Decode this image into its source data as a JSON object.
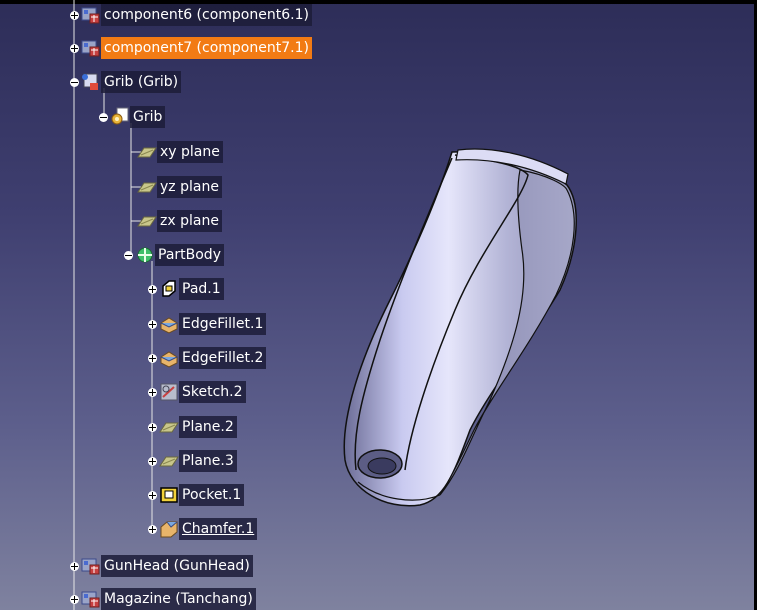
{
  "tree": {
    "nodes": [
      {
        "id": "component6",
        "label": "component6 (component6.1)",
        "icon": "component-icon",
        "expander": "plus",
        "selected": false
      },
      {
        "id": "component7",
        "label": "component7 (component7.1)",
        "icon": "component-icon",
        "expander": "plus",
        "selected": true
      },
      {
        "id": "grib-product",
        "label": "Grib (Grib)",
        "icon": "product-icon",
        "expander": "minus",
        "selected": false
      },
      {
        "id": "grib-part",
        "label": "Grib",
        "icon": "part-icon",
        "expander": "minus",
        "selected": false
      },
      {
        "id": "xy-plane",
        "label": "xy plane",
        "icon": "plane-icon",
        "expander": "none",
        "selected": false
      },
      {
        "id": "yz-plane",
        "label": "yz plane",
        "icon": "plane-icon",
        "expander": "none",
        "selected": false
      },
      {
        "id": "zx-plane",
        "label": "zx plane",
        "icon": "plane-icon",
        "expander": "none",
        "selected": false
      },
      {
        "id": "partbody",
        "label": "PartBody",
        "icon": "body-icon",
        "expander": "minus",
        "selected": false
      },
      {
        "id": "pad",
        "label": "Pad.1",
        "icon": "pad-icon",
        "expander": "plus",
        "selected": false
      },
      {
        "id": "edgefillet1",
        "label": "EdgeFillet.1",
        "icon": "fillet-icon",
        "expander": "plus",
        "selected": false
      },
      {
        "id": "edgefillet2",
        "label": "EdgeFillet.2",
        "icon": "fillet-icon",
        "expander": "plus",
        "selected": false
      },
      {
        "id": "sketch2",
        "label": "Sketch.2",
        "icon": "sketch-icon",
        "expander": "plus",
        "selected": false
      },
      {
        "id": "plane2",
        "label": "Plane.2",
        "icon": "plane-icon",
        "expander": "plus",
        "selected": false
      },
      {
        "id": "plane3",
        "label": "Plane.3",
        "icon": "plane-icon",
        "expander": "plus",
        "selected": false
      },
      {
        "id": "pocket1",
        "label": "Pocket.1",
        "icon": "pocket-icon",
        "expander": "plus",
        "selected": false
      },
      {
        "id": "chamfer1",
        "label": "Chamfer.1",
        "icon": "chamfer-icon",
        "expander": "plus",
        "selected": false,
        "underlined": true
      },
      {
        "id": "gunhead",
        "label": "GunHead (GunHead)",
        "icon": "component-icon",
        "expander": "plus",
        "selected": false
      },
      {
        "id": "magazine",
        "label": "Magazine (Tanchang)",
        "icon": "component-icon",
        "expander": "plus",
        "selected": false
      }
    ]
  },
  "colors": {
    "background_top": "#2d2d58",
    "background_bottom": "#7f829f",
    "selection": "#f27b14",
    "part_shade": "#a9aacd"
  }
}
